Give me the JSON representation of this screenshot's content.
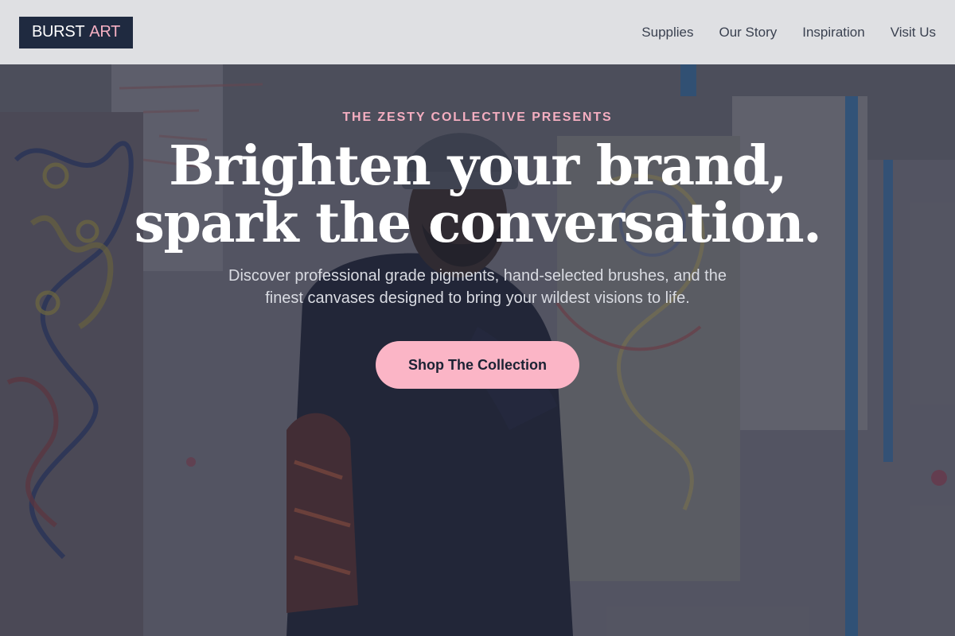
{
  "brand": {
    "part1": "BURST",
    "part2": "ART"
  },
  "nav": {
    "items": [
      {
        "label": "Supplies"
      },
      {
        "label": "Our Story"
      },
      {
        "label": "Inspiration"
      },
      {
        "label": "Visit Us"
      }
    ]
  },
  "hero": {
    "eyebrow": "THE ZESTY COLLECTIVE PRESENTS",
    "headline": {
      "line1": "Brighten your brand,",
      "line2": "spark the conversation."
    },
    "subtext": {
      "line1": "Discover professional grade pigments, hand-selected brushes, and the",
      "line2": "finest canvases designed to bring your wildest visions to life."
    },
    "cta_label": "Shop The Collection"
  },
  "colors": {
    "header_bg": "#dfe0e3",
    "logo_bg": "#1f2a40",
    "accent_pink": "#f6b0c3",
    "cta_bg": "#fbb5c6",
    "text_dark": "#1b2233"
  }
}
